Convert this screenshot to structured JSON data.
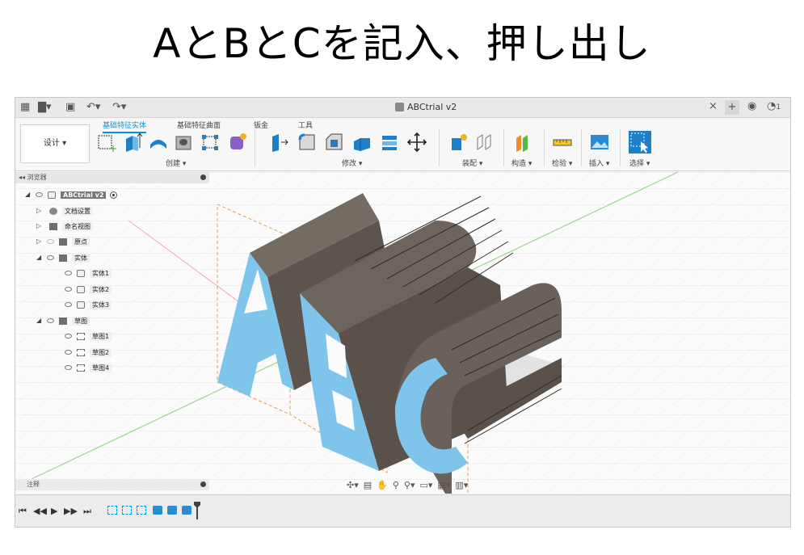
{
  "slide_title": "AとBとCを記入、押し出し",
  "app": {
    "document_title": "ABCtrial v2",
    "topbar_right": {
      "close": "×",
      "plus": "+",
      "notifications": "1"
    },
    "workspace_label": "设计 ▾",
    "tabs": [
      "基础特征实体",
      "基础特征曲面",
      "钣金",
      "工具"
    ],
    "groups": [
      "创建 ▾",
      "修改 ▾",
      "装配 ▾",
      "构造 ▾",
      "检验 ▾",
      "插入 ▾",
      "选择 ▾"
    ],
    "browser": {
      "header": "浏览器",
      "root": "ABCtrial v2",
      "items": [
        "文档设置",
        "命名视图",
        "原点",
        "实体",
        "实体1",
        "实体2",
        "实体3",
        "草图",
        "草图1",
        "草图2",
        "草图4"
      ]
    },
    "comments": "注释",
    "accent_color": "#0696d7",
    "face_highlight_color": "#7fc4ea",
    "body_color": "#6e645a"
  }
}
